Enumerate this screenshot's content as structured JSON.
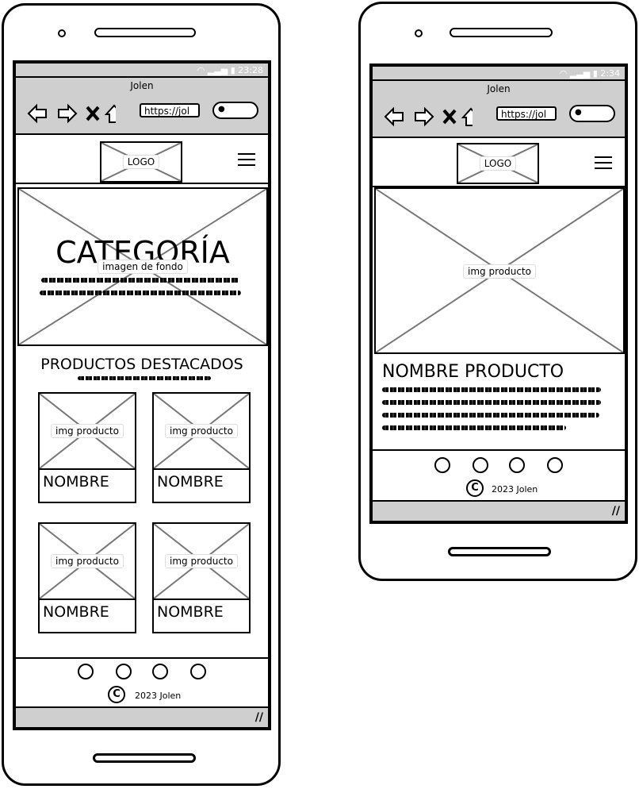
{
  "phone1": {
    "status_time": "23:28",
    "browser_title": "Jolen",
    "url": "https://jol",
    "logo": "LOGO",
    "hero_title": "CATEGORÍA",
    "hero_image_label": "imagen de fondo",
    "section_title": "PRODUCTOS DESTACADOS",
    "products": [
      {
        "image_label": "img producto",
        "name": "NOMBRE"
      },
      {
        "image_label": "img producto",
        "name": "NOMBRE"
      },
      {
        "image_label": "img producto",
        "name": "NOMBRE"
      },
      {
        "image_label": "img producto",
        "name": "NOMBRE"
      }
    ],
    "copyright_symbol": "C",
    "copyright": "2023 Jolen"
  },
  "phone2": {
    "status_time": "2:34",
    "browser_title": "Jolen",
    "url": "https://jol",
    "logo": "LOGO",
    "product_image_label": "img producto",
    "product_title": "NOMBRE PRODUCTO",
    "copyright_symbol": "C",
    "copyright": "2023 Jolen"
  },
  "icons": [
    "wifi-icon",
    "signal-icon",
    "battery-icon",
    "back-arrow-icon",
    "forward-arrow-icon",
    "close-icon",
    "home-icon",
    "search-icon",
    "hamburger-menu-icon",
    "social-circle-icon",
    "copyright-icon",
    "resize-grip-icon"
  ]
}
